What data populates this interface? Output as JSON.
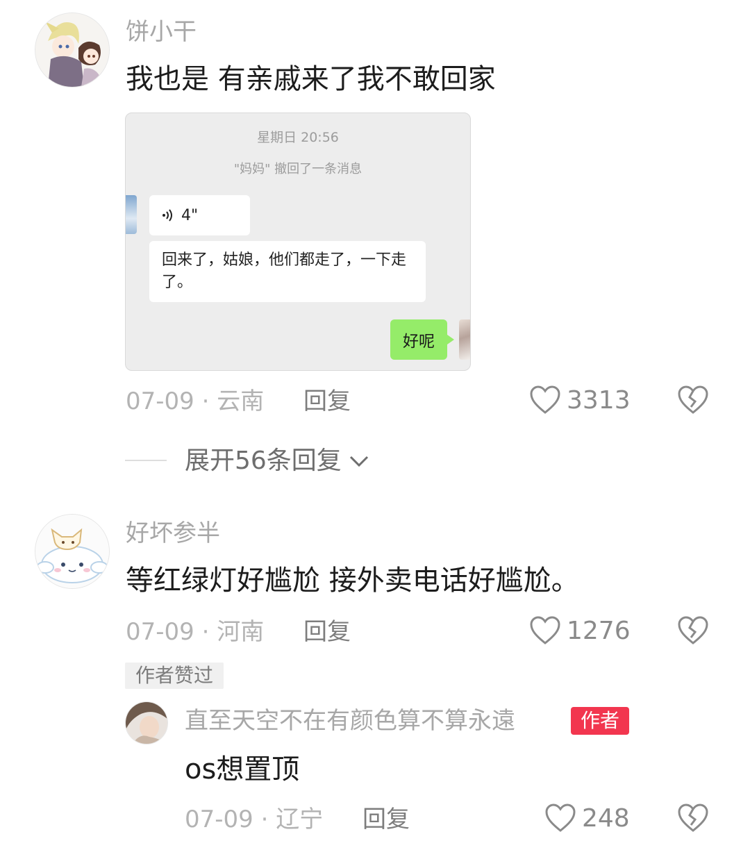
{
  "comments": [
    {
      "user": "饼小干",
      "text": "我也是 有亲戚来了我不敢回家",
      "date_location": "07-09 · 云南",
      "reply_label": "回复",
      "likes": "3313",
      "chat_image": {
        "time": "星期日 20:56",
        "recall_notice": "\"妈妈\" 撤回了一条消息",
        "voice_duration": "4\"",
        "text_message": "回来了，姑娘，他们都走了，一下走了。",
        "reply_message": "好呢"
      },
      "expand_label": "展开56条回复"
    },
    {
      "user": "好坏参半",
      "text": "等红绿灯好尴尬 接外卖电话好尴尬。",
      "date_location": "07-09 · 河南",
      "reply_label": "回复",
      "likes": "1276",
      "badge": "作者赞过",
      "reply": {
        "user": "直至天空不在有颜色算不算永遠",
        "author_tag": "作者",
        "text": "os想置顶",
        "date_location": "07-09 · 辽宁",
        "reply_label": "回复",
        "likes": "248"
      }
    }
  ]
}
